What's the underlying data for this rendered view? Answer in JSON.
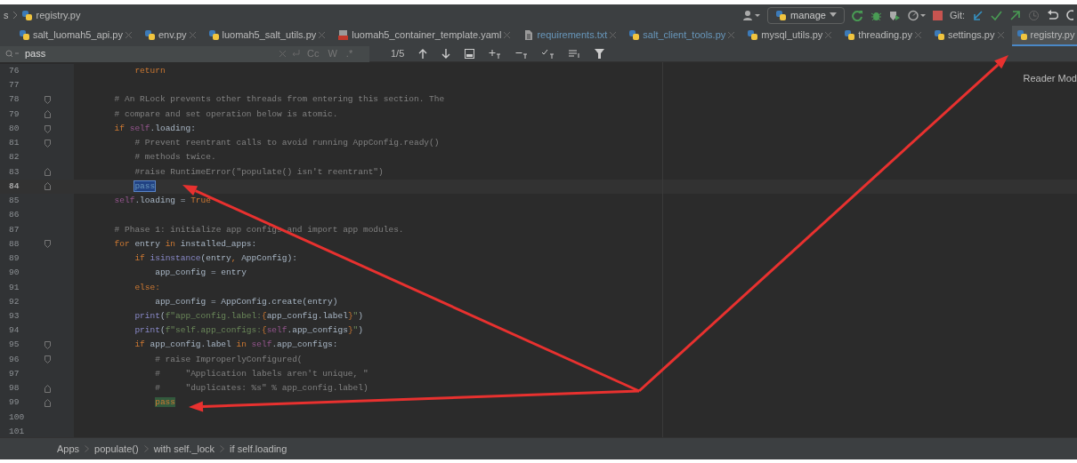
{
  "title_bar": {
    "path_prefix": "s",
    "file": "registry.py",
    "run_config": "manage",
    "vcs_label": "Git:"
  },
  "tabs": [
    {
      "label": "salt_luomah5_api.py",
      "kind": "python",
      "selected": false,
      "modified": false
    },
    {
      "label": "env.py",
      "kind": "python",
      "selected": false,
      "modified": false
    },
    {
      "label": "luomah5_salt_utils.py",
      "kind": "python",
      "selected": false,
      "modified": false
    },
    {
      "label": "luomah5_container_template.yaml",
      "kind": "yaml",
      "selected": false,
      "modified": false
    },
    {
      "label": "requirements.txt",
      "kind": "text",
      "selected": false,
      "modified": true
    },
    {
      "label": "salt_client_tools.py",
      "kind": "python",
      "selected": false,
      "modified": true
    },
    {
      "label": "mysql_utils.py",
      "kind": "python",
      "selected": false,
      "modified": false
    },
    {
      "label": "threading.py",
      "kind": "python",
      "selected": false,
      "modified": false
    },
    {
      "label": "settings.py",
      "kind": "python",
      "selected": false,
      "modified": false
    },
    {
      "label": "registry.py",
      "kind": "python",
      "selected": true,
      "modified": false
    }
  ],
  "search": {
    "value": "pass",
    "options": [
      "Cc",
      "W",
      ".*"
    ],
    "count": "1/5"
  },
  "editor": {
    "side_label": "Reader Mod",
    "lines": [
      {
        "number": "76",
        "current": false,
        "fold_start": false,
        "fold_end": false,
        "segments": [
          {
            "text": "            return",
            "kind": "keyword"
          }
        ]
      },
      {
        "number": "77",
        "current": false,
        "fold_start": false,
        "fold_end": false
      },
      {
        "number": "78",
        "current": false,
        "fold_start": true,
        "fold_end": false,
        "segments": [
          {
            "text": "        # An RLock prevents other threads from entering this section. The",
            "kind": "comment"
          }
        ]
      },
      {
        "number": "79",
        "current": false,
        "fold_start": false,
        "fold_end": true,
        "segments": [
          {
            "text": "        # compare and set operation below is atomic.",
            "kind": "comment"
          }
        ]
      },
      {
        "number": "80",
        "current": false,
        "fold_start": true,
        "fold_end": false,
        "segments": [
          {
            "text": "        if ",
            "kind": "keyword"
          },
          {
            "text": "self",
            "kind": "self"
          },
          {
            "text": ".loading:",
            "kind": "plain"
          }
        ]
      },
      {
        "number": "81",
        "current": false,
        "fold_start": true,
        "fold_end": false,
        "segments": [
          {
            "text": "            # Prevent reentrant calls to avoid running AppConfig.ready()",
            "kind": "comment"
          }
        ]
      },
      {
        "number": "82",
        "current": false,
        "fold_start": false,
        "fold_end": false,
        "segments": [
          {
            "text": "            # methods twice.",
            "kind": "comment"
          }
        ]
      },
      {
        "number": "83",
        "current": false,
        "fold_start": false,
        "fold_end": true,
        "segments": [
          {
            "text": "            #raise RuntimeError(\"populate() isn't reentrant\")",
            "kind": "comment"
          }
        ]
      },
      {
        "number": "84",
        "current": true,
        "fold_start": false,
        "fold_end": true,
        "segments": [
          {
            "text": "            pass",
            "kind": "match_current"
          }
        ]
      },
      {
        "number": "85",
        "current": false,
        "fold_start": false,
        "fold_end": false,
        "segments": [
          {
            "text": "        self",
            "kind": "self"
          },
          {
            "text": ".loading = ",
            "kind": "plain"
          },
          {
            "text": "True",
            "kind": "keyword"
          }
        ]
      },
      {
        "number": "86",
        "current": false,
        "fold_start": false,
        "fold_end": false
      },
      {
        "number": "87",
        "current": false,
        "fold_start": false,
        "fold_end": false,
        "segments": [
          {
            "text": "        # Phase 1: initialize app configs and import app modules.",
            "kind": "comment"
          }
        ]
      },
      {
        "number": "88",
        "current": false,
        "fold_start": true,
        "fold_end": false,
        "segments": [
          {
            "text": "        for",
            "kind": "keyword"
          },
          {
            "text": " entry ",
            "kind": "plain"
          },
          {
            "text": "in",
            "kind": "keyword"
          },
          {
            "text": " installed_apps:",
            "kind": "plain"
          }
        ]
      },
      {
        "number": "89",
        "current": false,
        "fold_start": false,
        "fold_end": false,
        "segments": [
          {
            "text": "            if ",
            "kind": "keyword"
          },
          {
            "text": "isinstance",
            "kind": "builtin"
          },
          {
            "text": "(entry",
            "kind": "plain"
          },
          {
            "text": ", ",
            "kind": "keyword"
          },
          {
            "text": "AppConfig):",
            "kind": "plain"
          }
        ]
      },
      {
        "number": "90",
        "current": false,
        "fold_start": false,
        "fold_end": false,
        "segments": [
          {
            "text": "                app_config = entry",
            "kind": "plain"
          }
        ]
      },
      {
        "number": "91",
        "current": false,
        "fold_start": false,
        "fold_end": false,
        "segments": [
          {
            "text": "            else:",
            "kind": "keyword"
          }
        ]
      },
      {
        "number": "92",
        "current": false,
        "fold_start": false,
        "fold_end": false,
        "segments": [
          {
            "text": "                app_config = AppConfig.create(entry)",
            "kind": "plain"
          }
        ]
      },
      {
        "number": "93",
        "current": false,
        "fold_start": false,
        "fold_end": false,
        "segments": [
          {
            "text": "            print",
            "kind": "builtin"
          },
          {
            "text": "(",
            "kind": "plain"
          },
          {
            "text": "f\"app_config.label:",
            "kind": "string"
          },
          {
            "text": "{",
            "kind": "keyword"
          },
          {
            "text": "app_config.label",
            "kind": "plain"
          },
          {
            "text": "}",
            "kind": "keyword"
          },
          {
            "text": "\"",
            "kind": "string"
          },
          {
            "text": ")",
            "kind": "plain"
          }
        ]
      },
      {
        "number": "94",
        "current": false,
        "fold_start": false,
        "fold_end": false,
        "segments": [
          {
            "text": "            print",
            "kind": "builtin"
          },
          {
            "text": "(",
            "kind": "plain"
          },
          {
            "text": "f\"self.app_configs:",
            "kind": "string"
          },
          {
            "text": "{",
            "kind": "keyword"
          },
          {
            "text": "self",
            "kind": "self"
          },
          {
            "text": ".app_configs",
            "kind": "plain"
          },
          {
            "text": "}",
            "kind": "keyword"
          },
          {
            "text": "\"",
            "kind": "string"
          },
          {
            "text": ")",
            "kind": "plain"
          }
        ]
      },
      {
        "number": "95",
        "current": false,
        "fold_start": true,
        "fold_end": false,
        "segments": [
          {
            "text": "            if",
            "kind": "keyword"
          },
          {
            "text": " app_config.label ",
            "kind": "plain"
          },
          {
            "text": "in ",
            "kind": "keyword"
          },
          {
            "text": "self",
            "kind": "self"
          },
          {
            "text": ".app_configs:",
            "kind": "plain"
          }
        ]
      },
      {
        "number": "96",
        "current": false,
        "fold_start": true,
        "fold_end": false,
        "segments": [
          {
            "text": "                # raise ImproperlyConfigured(",
            "kind": "comment"
          }
        ]
      },
      {
        "number": "97",
        "current": false,
        "fold_start": false,
        "fold_end": false,
        "segments": [
          {
            "text": "                #     \"Application labels aren't unique, \"",
            "kind": "comment"
          }
        ]
      },
      {
        "number": "98",
        "current": false,
        "fold_start": false,
        "fold_end": true,
        "segments": [
          {
            "text": "                #     \"duplicates: %s\" % app_config.label)",
            "kind": "comment"
          }
        ]
      },
      {
        "number": "99",
        "current": false,
        "fold_start": false,
        "fold_end": true,
        "segments": [
          {
            "text": "                pass",
            "kind": "match"
          }
        ]
      },
      {
        "number": "100",
        "current": false,
        "fold_start": false,
        "fold_end": false
      },
      {
        "number": "101",
        "current": false,
        "fold_start": false,
        "fold_end": false
      }
    ]
  },
  "breadcrumbs": [
    "Apps",
    "populate()",
    "with self._lock",
    "if self.loading"
  ]
}
